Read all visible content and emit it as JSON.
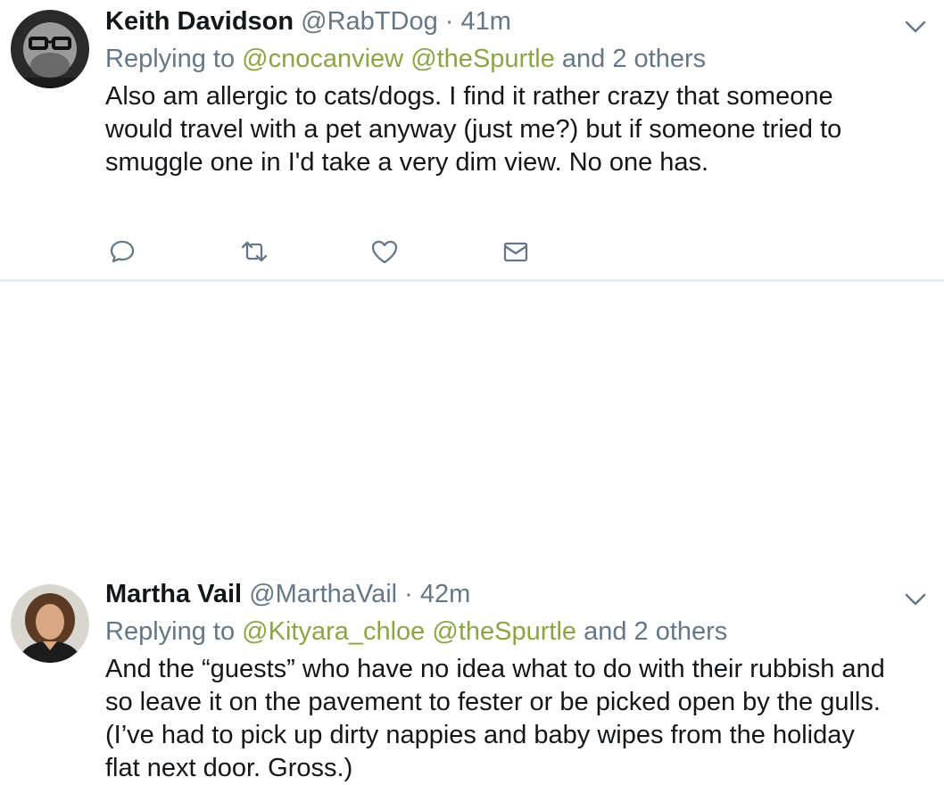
{
  "tweets": [
    {
      "name": "Keith Davidson",
      "handle": "@RabTDog",
      "separator": "·",
      "time": "41m",
      "replying_prefix": "Replying to",
      "mention1": "@cnocanview",
      "mention2": "@theSpurtle",
      "replying_suffix": "and 2 others",
      "text": "Also am allergic to cats/dogs. I find it rather crazy that someone would travel with a pet anyway (just me?) but if someone tried to smuggle one in I'd take a very dim view. No one has."
    },
    {
      "name": "Martha Vail",
      "handle": "@MarthaVail",
      "separator": "·",
      "time": "42m",
      "replying_prefix": "Replying to",
      "mention1": "@Kityara_chloe",
      "mention2": "@theSpurtle",
      "replying_suffix": "and 2 others",
      "text": "And the “guests” who have no idea what to do with their rubbish and so leave it on the pavement to fester or be picked open by the gulls. (I’ve had to pick up dirty nappies and baby wipes from the holiday flat next door. Gross.)"
    }
  ],
  "icons": {
    "reply": "reply-icon",
    "retweet": "retweet-icon",
    "like": "heart-icon",
    "dm": "mail-icon",
    "more": "chevron-down-icon"
  },
  "colors": {
    "mention": "#8ba545",
    "meta": "#657786",
    "text": "#14171a",
    "divider": "#e6ecf0"
  }
}
